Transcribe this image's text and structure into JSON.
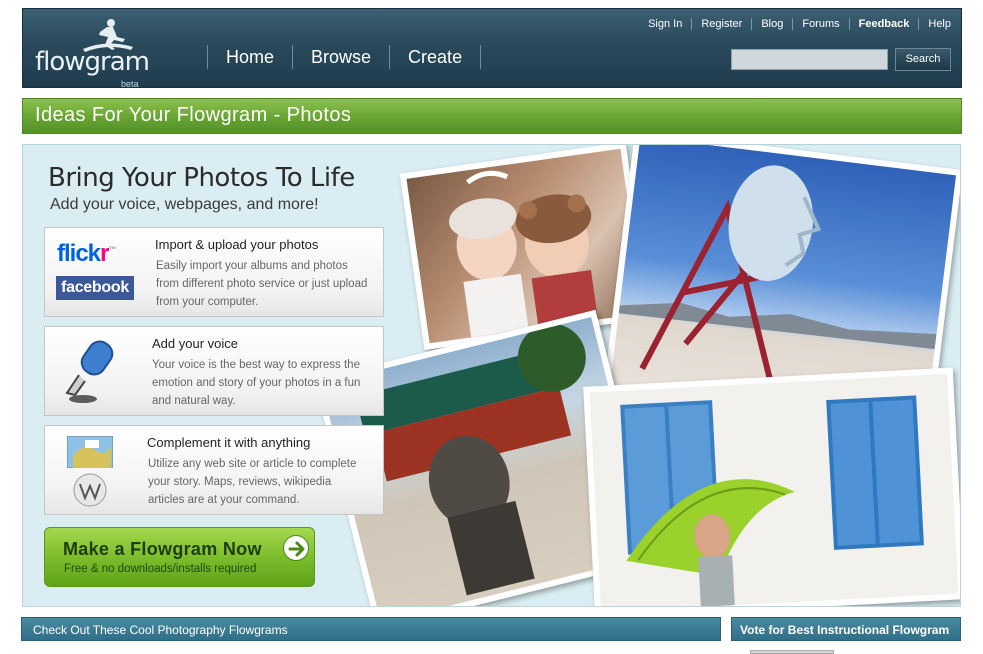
{
  "header": {
    "logo_text": "flowgram",
    "logo_badge": "beta",
    "nav": [
      "Home",
      "Browse",
      "Create"
    ],
    "top_links": [
      "Sign In",
      "Register",
      "Blog",
      "Forums",
      "Feedback",
      "Help"
    ],
    "search_button": "Search",
    "search_placeholder": ""
  },
  "page_title": "Ideas For Your Flowgram - Photos",
  "hero": {
    "title": "Bring Your Photos To Life",
    "subtitle": "Add your voice, webpages, and more!",
    "features": [
      {
        "title": "Import & upload your photos",
        "body": "Easily import your albums and photos from different photo service or just upload from your computer.",
        "logos": [
          "flickr",
          "facebook"
        ]
      },
      {
        "title": "Add your voice",
        "body": "Your voice is the best way to express the emotion and story of your photos in a fun and natural way."
      },
      {
        "title": "Complement it with anything",
        "body": "Utilize any web site or article to complete your story. Maps, reviews, wikipedia articles are at your command."
      }
    ],
    "flickr_blue": "flickr",
    "flickr_tm": "™",
    "facebook_label": "facebook",
    "cta": {
      "label": "Make a Flowgram Now",
      "sub": "Free & no downloads/installs required"
    }
  },
  "bottom": {
    "left_heading": "Check Out These Cool Photography Flowgrams",
    "right_heading": "Vote for Best Instructional Flowgram"
  },
  "colors": {
    "header_bg": "#2a4a5c",
    "title_green": "#68a432",
    "hero_bg": "#d9edf3",
    "bar_teal": "#2f6f87",
    "cta_green": "#7dbd2c"
  }
}
